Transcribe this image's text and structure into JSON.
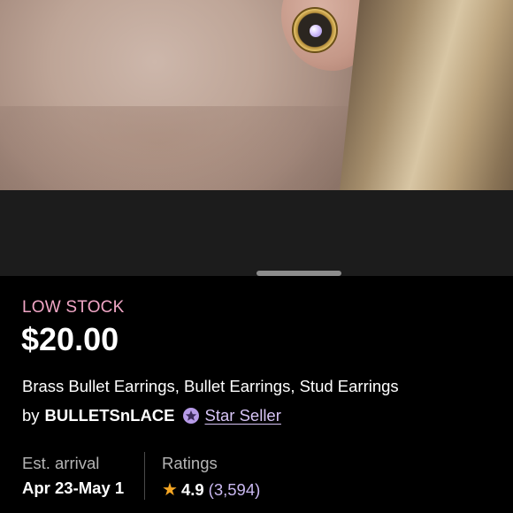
{
  "product": {
    "stock_status": "LOW STOCK",
    "price": "$20.00",
    "title": "Brass Bullet Earrings, Bullet Earrings, Stud Earrings"
  },
  "seller": {
    "by_label": "by",
    "shop_name": "BULLETSnLACE",
    "badge_icon": "star-seller-badge-icon",
    "badge_label": "Star Seller"
  },
  "details": {
    "arrival_label": "Est. arrival",
    "arrival_value": "Apr 23-May 1",
    "ratings_label": "Ratings",
    "rating_icon": "star-icon",
    "rating_value": "4.9",
    "rating_count": "(3,594)"
  },
  "colors": {
    "low_stock": "#f1a6c6",
    "star_seller_link": "#d7c4f5",
    "rating_star": "#f5a623",
    "rating_count": "#c9b8f0",
    "background": "#000000"
  }
}
